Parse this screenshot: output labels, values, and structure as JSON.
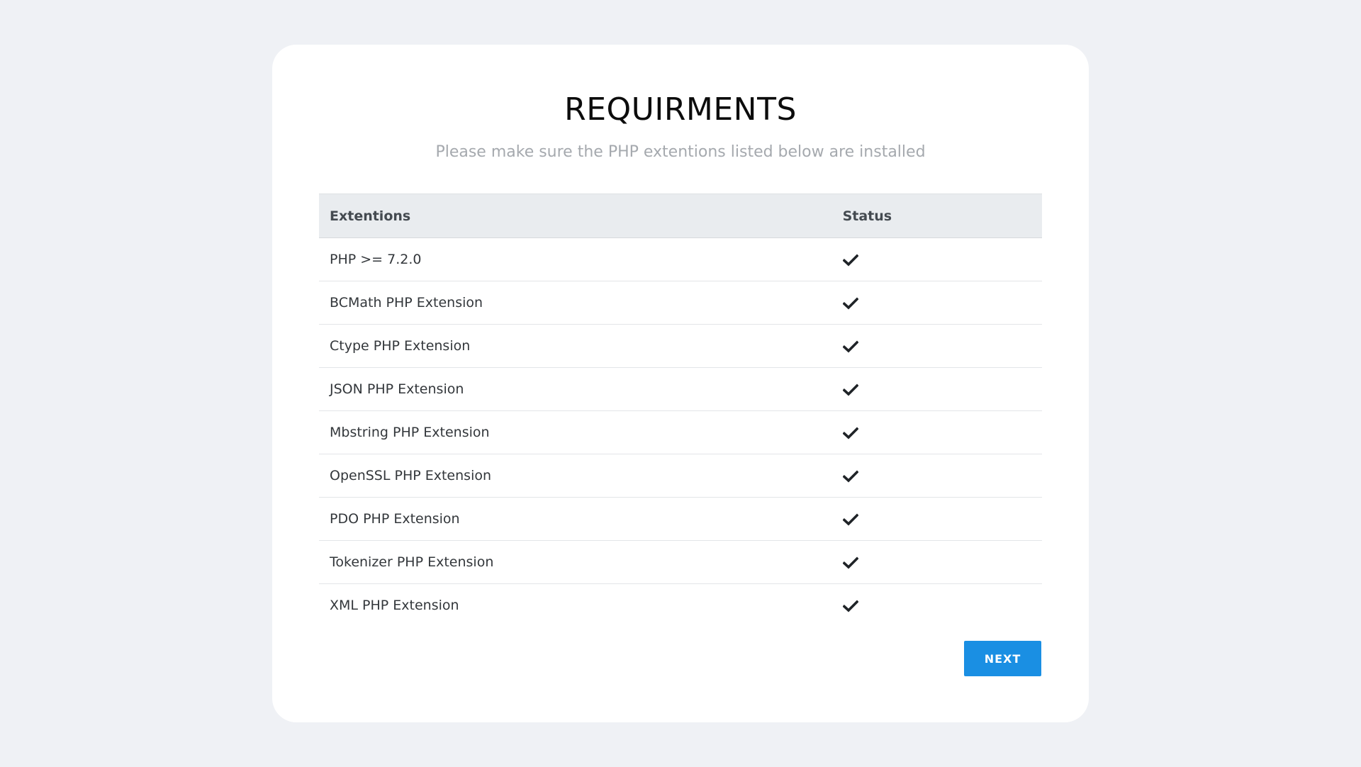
{
  "header": {
    "title": "REQUIRMENTS",
    "subtitle": "Please make sure the PHP extentions listed below are installed"
  },
  "table": {
    "columns": [
      "Extentions",
      "Status"
    ],
    "rows": [
      {
        "name": "PHP >= 7.2.0",
        "status": "check-icon"
      },
      {
        "name": "BCMath PHP Extension",
        "status": "check-icon"
      },
      {
        "name": "Ctype PHP Extension",
        "status": "check-icon"
      },
      {
        "name": "JSON PHP Extension",
        "status": "check-icon"
      },
      {
        "name": "Mbstring PHP Extension",
        "status": "check-icon"
      },
      {
        "name": "OpenSSL PHP Extension",
        "status": "check-icon"
      },
      {
        "name": "PDO PHP Extension",
        "status": "check-icon"
      },
      {
        "name": "Tokenizer PHP Extension",
        "status": "check-icon"
      },
      {
        "name": "XML PHP Extension",
        "status": "check-icon"
      }
    ]
  },
  "actions": {
    "next_label": "NEXT"
  },
  "colors": {
    "background": "#eff1f5",
    "card": "#ffffff",
    "accent": "#1a8fe3",
    "header_row": "#e9ecef"
  }
}
